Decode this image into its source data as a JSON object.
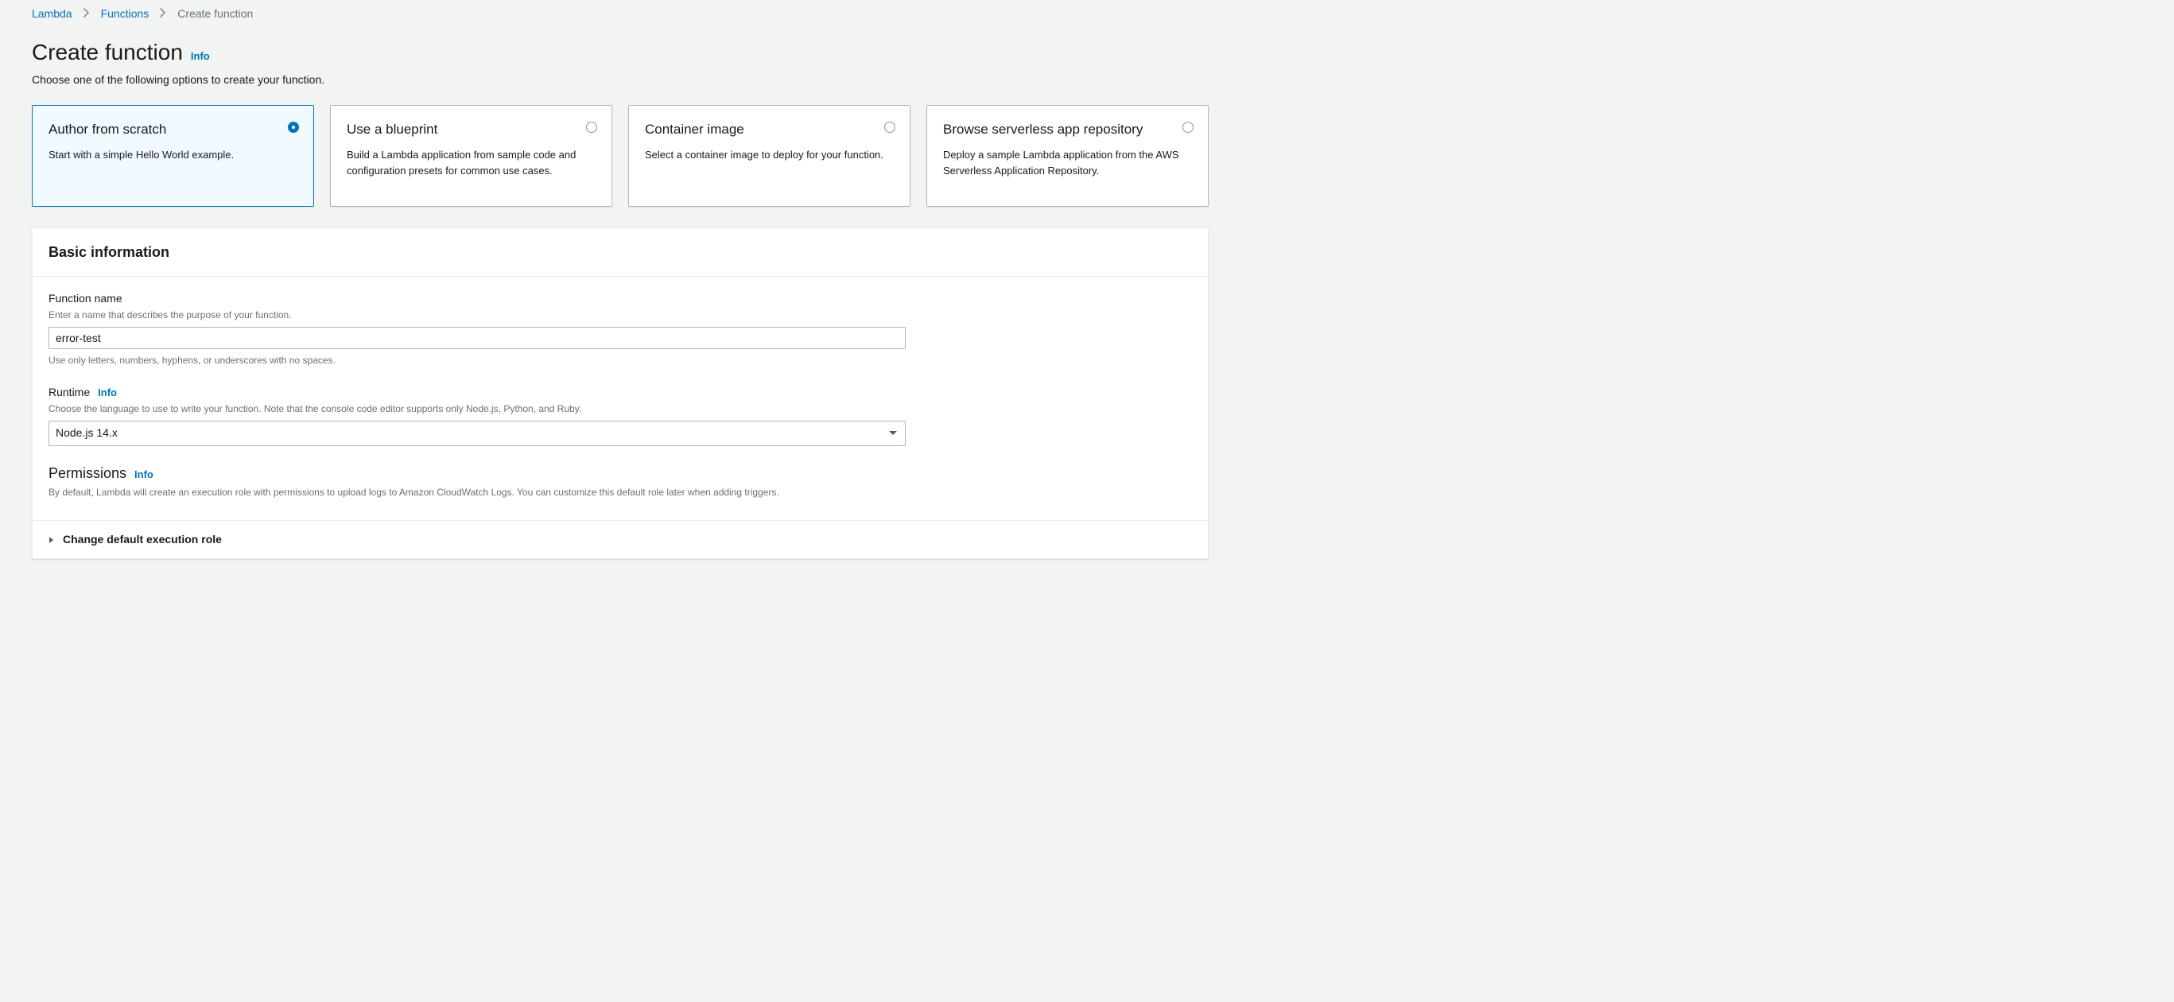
{
  "breadcrumbs": {
    "items": [
      {
        "label": "Lambda",
        "link": true
      },
      {
        "label": "Functions",
        "link": true
      },
      {
        "label": "Create function",
        "link": false
      }
    ]
  },
  "heading": {
    "title": "Create function",
    "info": "Info",
    "subtitle": "Choose one of the following options to create your function."
  },
  "options": [
    {
      "title": "Author from scratch",
      "desc": "Start with a simple Hello World example.",
      "selected": true
    },
    {
      "title": "Use a blueprint",
      "desc": "Build a Lambda application from sample code and configuration presets for common use cases.",
      "selected": false
    },
    {
      "title": "Container image",
      "desc": "Select a container image to deploy for your function.",
      "selected": false
    },
    {
      "title": "Browse serverless app repository",
      "desc": "Deploy a sample Lambda application from the AWS Serverless Application Repository.",
      "selected": false
    }
  ],
  "panel": {
    "title": "Basic information",
    "functionName": {
      "label": "Function name",
      "hint": "Enter a name that describes the purpose of your function.",
      "value": "error-test",
      "constraint": "Use only letters, numbers, hyphens, or underscores with no spaces."
    },
    "runtime": {
      "label": "Runtime",
      "info": "Info",
      "hint": "Choose the language to use to write your function. Note that the console code editor supports only Node.js, Python, and Ruby.",
      "value": "Node.js 14.x"
    },
    "permissions": {
      "label": "Permissions",
      "info": "Info",
      "desc": "By default, Lambda will create an execution role with permissions to upload logs to Amazon CloudWatch Logs. You can customize this default role later when adding triggers."
    },
    "expand": {
      "title": "Change default execution role"
    }
  }
}
